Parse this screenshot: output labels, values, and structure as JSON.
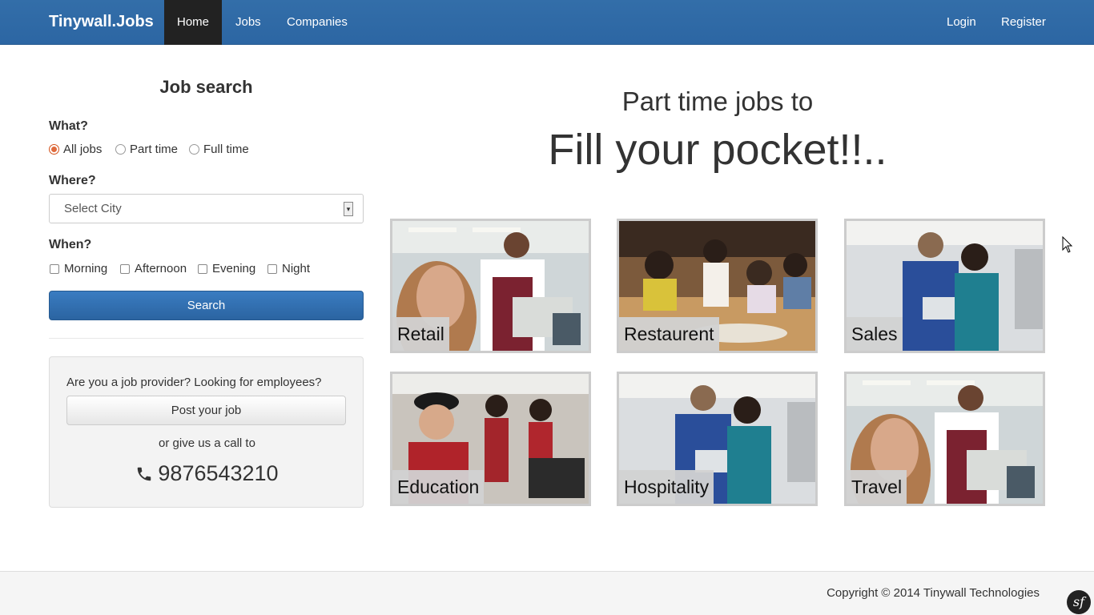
{
  "nav": {
    "brand": "Tinywall.Jobs",
    "items": [
      {
        "label": "Home",
        "active": true
      },
      {
        "label": "Jobs"
      },
      {
        "label": "Companies"
      }
    ],
    "right": [
      {
        "label": "Login"
      },
      {
        "label": "Register"
      }
    ]
  },
  "search": {
    "title": "Job search",
    "what_label": "What?",
    "what_options": [
      "All jobs",
      "Part time",
      "Full time"
    ],
    "what_selected": "All jobs",
    "where_label": "Where?",
    "city_placeholder": "Select City",
    "when_label": "When?",
    "when_options": [
      "Morning",
      "Afternoon",
      "Evening",
      "Night"
    ],
    "search_button": "Search"
  },
  "provider": {
    "question": "Are you a job provider? Looking for employees?",
    "post_button": "Post your job",
    "call_text": "or give us a call to",
    "phone": "9876543210",
    "phone_icon": "phone-icon"
  },
  "hero": {
    "subtitle": "Part time jobs to",
    "title": "Fill your pocket!!.."
  },
  "categories": [
    {
      "label": "Retail"
    },
    {
      "label": "Restaurent"
    },
    {
      "label": "Sales"
    },
    {
      "label": "Education"
    },
    {
      "label": "Hospitality"
    },
    {
      "label": "Travel"
    }
  ],
  "footer": {
    "copyright": "Copyright © 2014 Tinywall Technologies",
    "badge": "sf"
  },
  "colors": {
    "navbar": "#2c66a3",
    "nav_active": "#222222",
    "primary_button": "#2b64a1"
  }
}
